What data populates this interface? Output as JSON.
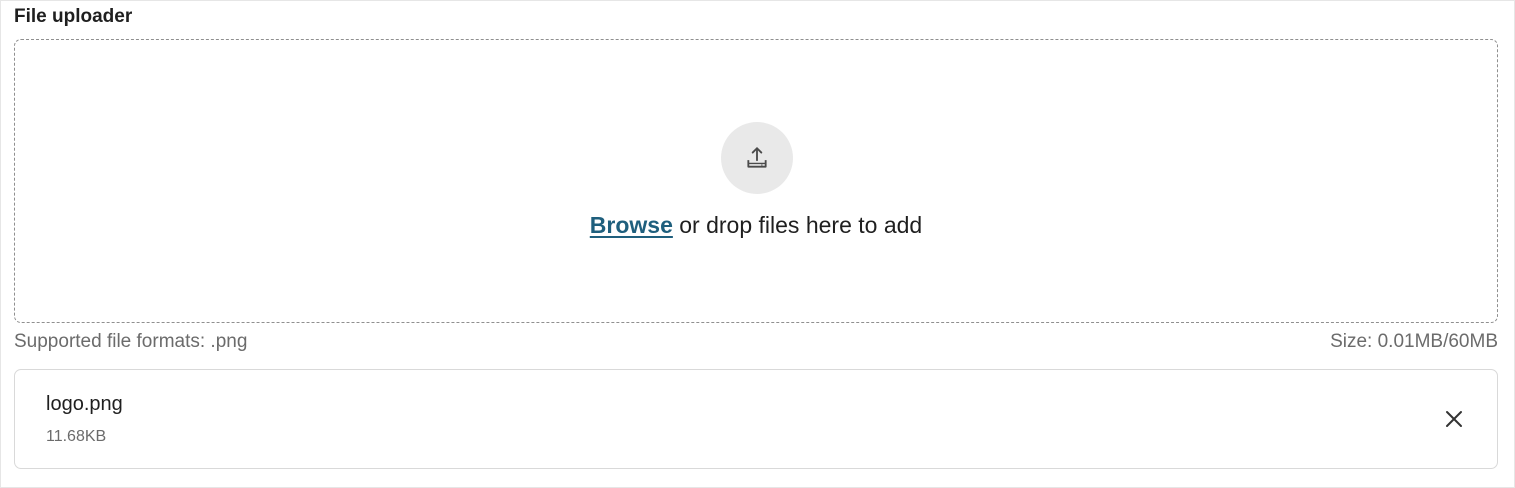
{
  "uploader": {
    "title": "File uploader",
    "browse_label": "Browse",
    "drop_text": " or drop files here to add",
    "icon": "upload-icon",
    "supported_formats": "Supported file formats: .png",
    "size_text": "Size: 0.01MB/60MB"
  },
  "files": [
    {
      "name": "logo.png",
      "size": "11.68KB",
      "remove_icon": "close-icon"
    }
  ],
  "colors": {
    "link": "#1f5f7d",
    "muted_text": "#6b6b6b",
    "icon_circle": "#e9e9e9",
    "border_dashed": "#8f8f8f"
  }
}
